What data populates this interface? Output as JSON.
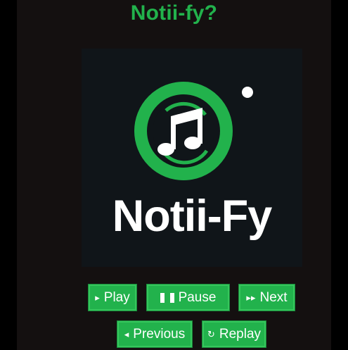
{
  "page": {
    "title": "Notii-fy?"
  },
  "logo": {
    "wordmark": "Notii-Fy",
    "accent_color": "#22b24c",
    "icon": "music-note-icon"
  },
  "controls": {
    "play_label": "Play",
    "pause_label": "Pause",
    "next_label": "Next",
    "previous_label": "Previous",
    "replay_label": "Replay",
    "play_icon": "▸",
    "next_icon": "▸▸",
    "previous_icon": "◂",
    "replay_icon": "↻"
  }
}
